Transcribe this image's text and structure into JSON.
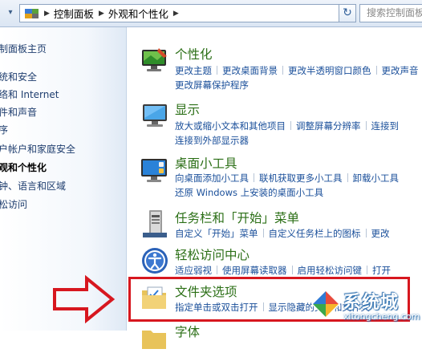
{
  "address_bar": {
    "crumbs": [
      "控制面板",
      "外观和个性化"
    ],
    "search_placeholder": "搜索控制面板"
  },
  "sidebar": {
    "items": [
      {
        "label": "制面板主页"
      },
      {
        "label": "统和安全"
      },
      {
        "label": "络和 Internet"
      },
      {
        "label": "件和声音"
      },
      {
        "label": "序"
      },
      {
        "label": "户帐户和家庭安全"
      },
      {
        "label": "观和个性化"
      },
      {
        "label": "钟、语言和区域"
      },
      {
        "label": "松访问"
      }
    ]
  },
  "categories": [
    {
      "title": "个性化",
      "icon": "personalization-icon",
      "link_rows": [
        [
          "更改主题",
          "更改桌面背景",
          "更改半透明窗口颜色",
          "更改声音"
        ],
        [
          "更改屏幕保护程序"
        ]
      ]
    },
    {
      "title": "显示",
      "icon": "display-icon",
      "link_rows": [
        [
          "放大或缩小文本和其他项目",
          "调整屏幕分辨率",
          "连接到"
        ],
        [
          "连接到外部显示器"
        ]
      ]
    },
    {
      "title": "桌面小工具",
      "icon": "gadgets-icon",
      "link_rows": [
        [
          "向桌面添加小工具",
          "联机获取更多小工具",
          "卸载小工具"
        ],
        [
          "还原 Windows 上安装的桌面小工具"
        ]
      ]
    },
    {
      "title": "任务栏和「开始」菜单",
      "icon": "taskbar-icon",
      "link_rows": [
        [
          "自定义「开始」菜单",
          "自定义任务栏上的图标",
          "更改"
        ]
      ]
    },
    {
      "title": "轻松访问中心",
      "icon": "ease-of-access-icon",
      "link_rows": [
        [
          "适应弱视",
          "使用屏幕读取器",
          "启用轻松访问键",
          "打开"
        ]
      ]
    },
    {
      "title": "文件夹选项",
      "icon": "folder-options-icon",
      "link_rows": [
        [
          "指定单击或双击打开",
          "显示隐藏的文件和文件夹"
        ]
      ]
    },
    {
      "title": "字体",
      "icon": "fonts-icon",
      "link_rows": []
    }
  ],
  "watermark": {
    "text": "系统城",
    "url": "xitongcheng.com"
  },
  "colors": {
    "highlight": "#d7171f",
    "title_green": "#2b6f16",
    "link_blue": "#1a4f9a"
  }
}
